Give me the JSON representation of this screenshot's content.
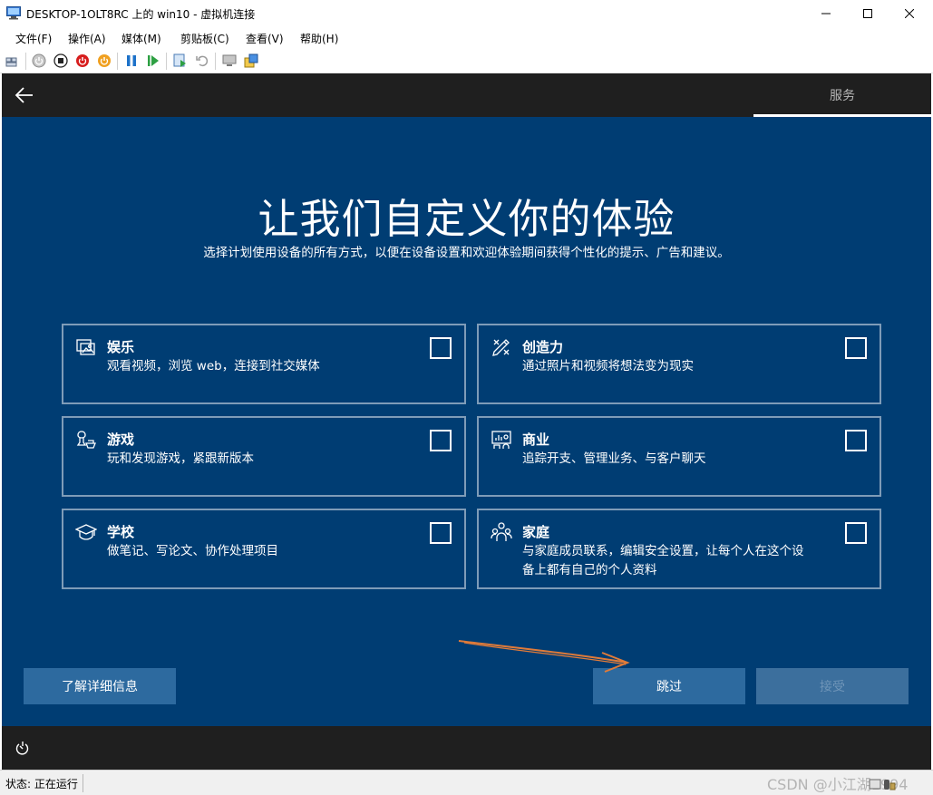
{
  "window": {
    "title": "DESKTOP-1OLT8RC 上的 win10 - 虚拟机连接"
  },
  "menu": [
    "文件(F)",
    "操作(A)",
    "媒体(M)",
    "剪贴板(C)",
    "查看(V)",
    "帮助(H)"
  ],
  "toolbar_icons": [
    "ctrl-alt-del-icon",
    "start-icon",
    "turn-off-icon",
    "shutdown-icon",
    "power-icon",
    "pause-icon",
    "resume-icon",
    "checkpoint-icon",
    "revert-icon",
    "enhanced-session-icon",
    "share-icon"
  ],
  "oobe": {
    "header_tab": "服务",
    "title": "让我们自定义你的体验",
    "subtitle": "选择计划使用设备的所有方式，以便在设备设置和欢迎体验期间获得个性化的提示、广告和建议。",
    "cards": [
      {
        "title": "娱乐",
        "desc": "观看视频，浏览 web，连接到社交媒体",
        "icon": "entertainment-icon",
        "checked": false
      },
      {
        "title": "创造力",
        "desc": "通过照片和视频将想法变为现实",
        "icon": "creativity-icon",
        "checked": false
      },
      {
        "title": "游戏",
        "desc": "玩和发现游戏，紧跟新版本",
        "icon": "gaming-icon",
        "checked": false
      },
      {
        "title": "商业",
        "desc": "追踪开支、管理业务、与客户聊天",
        "icon": "business-icon",
        "checked": false
      },
      {
        "title": "学校",
        "desc": "做笔记、写论文、协作处理项目",
        "icon": "school-icon",
        "checked": false
      },
      {
        "title": "家庭",
        "desc": "与家庭成员联系，编辑安全设置，让每个人在这个设备上都有自己的个人资料",
        "icon": "family-icon",
        "checked": false
      }
    ],
    "learn_more_label": "了解详细信息",
    "skip_label": "跳过",
    "accept_label": "接受",
    "accept_enabled": false
  },
  "status": {
    "text": "状态: 正在运行"
  },
  "watermark": "CSDN @小江湖1994",
  "colors": {
    "vm_background": "#003d73",
    "bar_background": "#1f1f1f",
    "button": "#2d6a9f",
    "annotation_arrow": "#e07b39"
  }
}
